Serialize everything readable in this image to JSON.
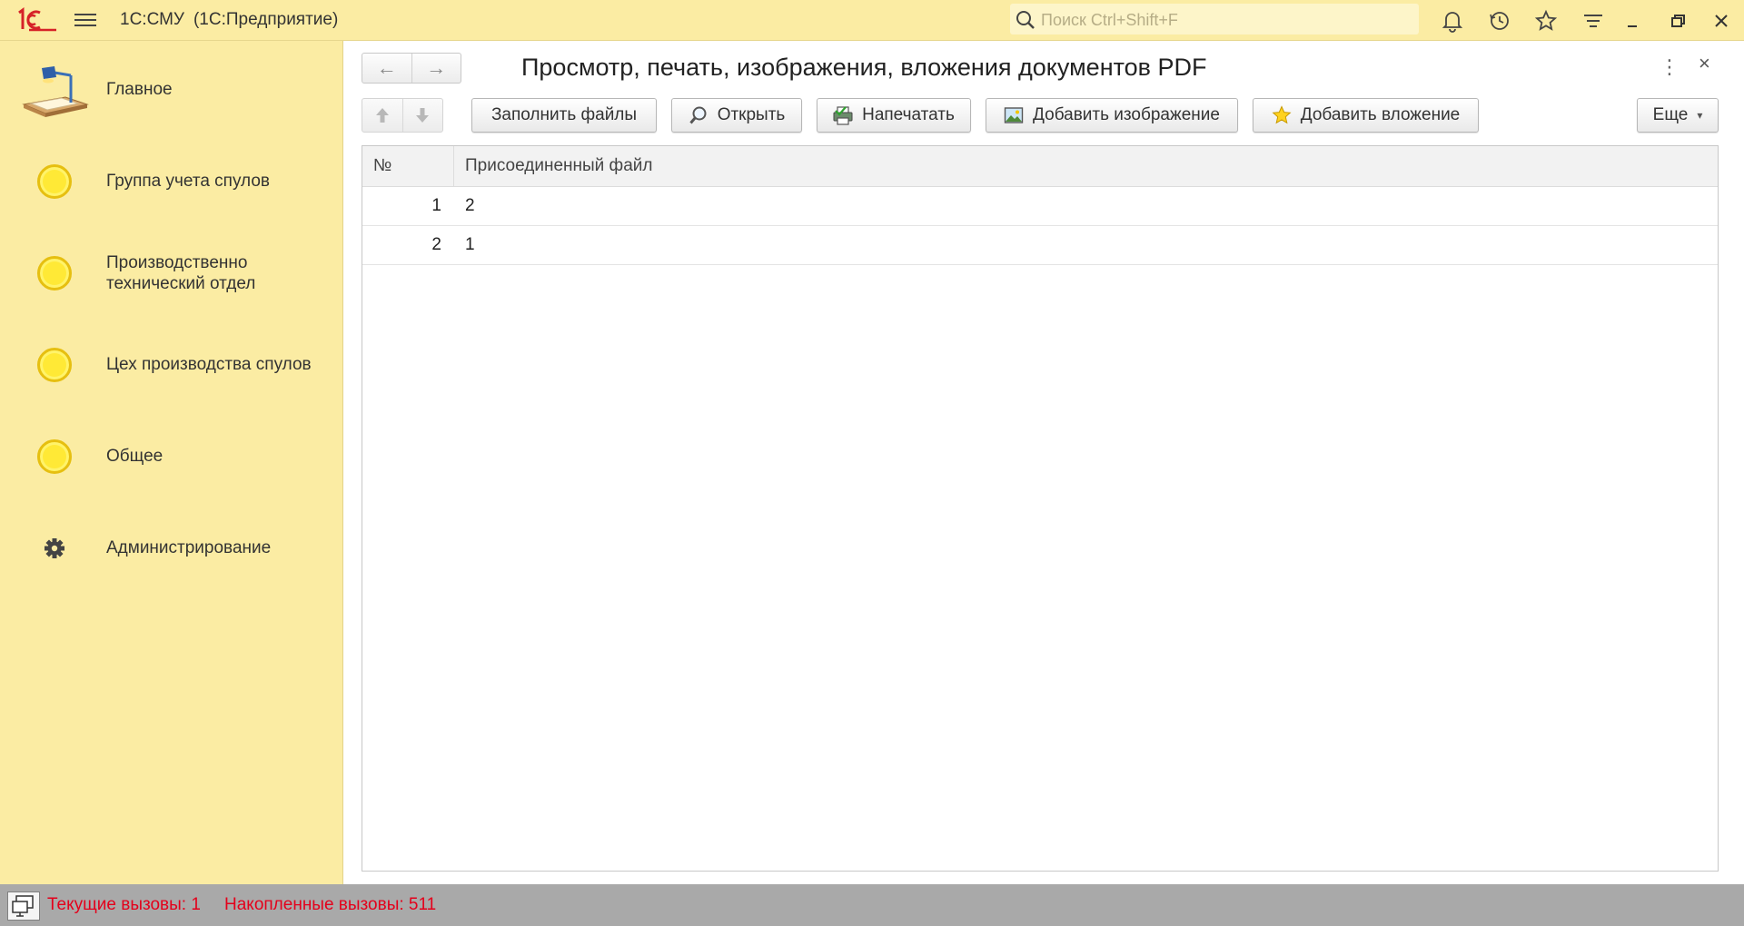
{
  "app": {
    "name": "1С:СМУ",
    "mode": "(1С:Предприятие)",
    "search_placeholder": "Поиск Ctrl+Shift+F"
  },
  "titlebar_icons": [
    "bell-icon",
    "history-icon",
    "star-icon",
    "filter-icon",
    "minimize-icon",
    "restore-icon",
    "close-icon"
  ],
  "sidebar": {
    "items": [
      {
        "label": "Главное",
        "icon": "desk-lamp-icon"
      },
      {
        "label": "Группа учета спулов",
        "icon": "yellow-circle-icon"
      },
      {
        "label": "Производственно технический отдел",
        "icon": "yellow-circle-icon"
      },
      {
        "label": "Цех производства спулов",
        "icon": "yellow-circle-icon"
      },
      {
        "label": "Общее",
        "icon": "yellow-circle-icon"
      },
      {
        "label": "Администрирование",
        "icon": "gear-icon"
      }
    ]
  },
  "form": {
    "title": "Просмотр, печать, изображения, вложения документов PDF",
    "toolbar": {
      "fill_files": "Заполнить файлы",
      "open": "Открыть",
      "print": "Напечатать",
      "add_image": "Добавить изображение",
      "add_attachment": "Добавить вложение",
      "more": "Еще"
    },
    "table": {
      "columns": [
        "№",
        "Присоединенный файл"
      ],
      "rows": [
        {
          "num": "1",
          "file": "2"
        },
        {
          "num": "2",
          "file": "1"
        }
      ]
    }
  },
  "statusbar": {
    "current_calls": "Текущие вызовы: 1",
    "accumulated_calls": "Накопленные вызовы: 511"
  },
  "colors": {
    "panel_yellow": "#fbeca3",
    "status_red": "#e4001b",
    "status_gray": "#a9a9a9"
  }
}
